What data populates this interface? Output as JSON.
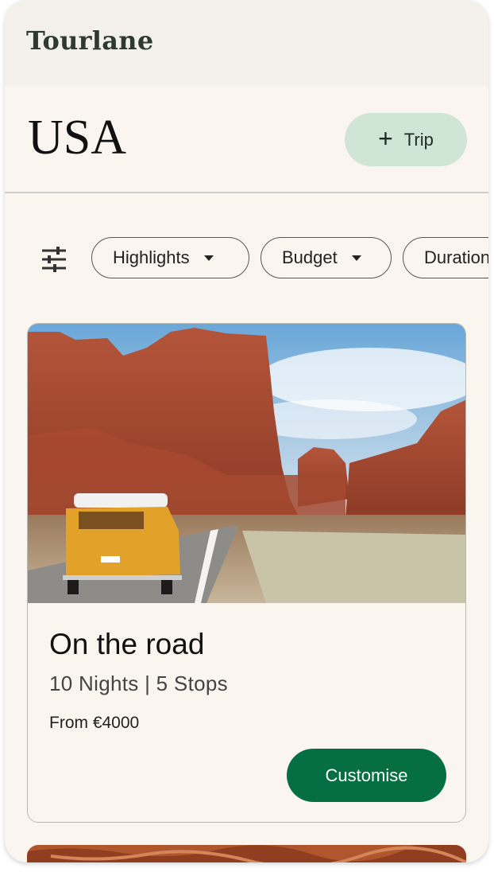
{
  "brand": "Tourlane",
  "page": {
    "title": "USA"
  },
  "actions": {
    "add_trip_icon": "+",
    "add_trip_label": "Trip"
  },
  "filters": {
    "icon": "sliders-icon",
    "chips": [
      "Highlights",
      "Budget",
      "Duration"
    ]
  },
  "trip_card": {
    "image": "camper-van-on-desert-road-photo",
    "title": "On the road",
    "subtitle": "10 Nights | 5 Stops",
    "price": "From €4000",
    "cta_label": "Customise"
  },
  "colors": {
    "background": "#faf6ef",
    "topbar": "#f3f1e9",
    "trip_button": "#cfe6d4",
    "cta": "#066f41"
  }
}
